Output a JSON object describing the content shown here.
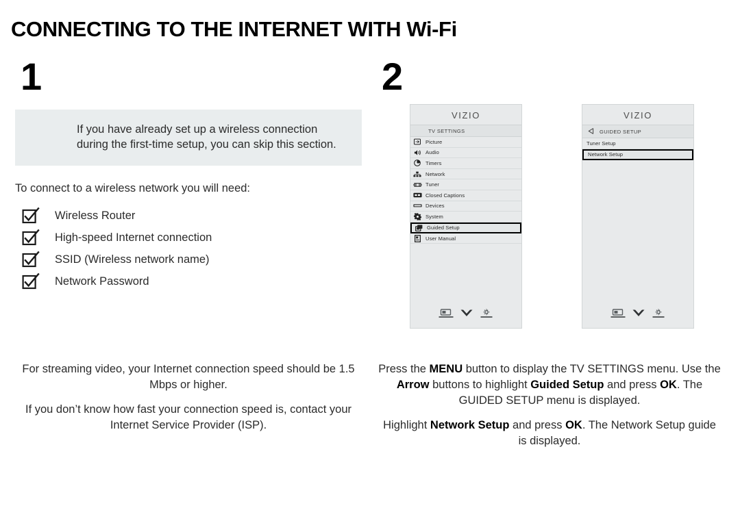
{
  "page": {
    "title": "CONNECTING TO THE INTERNET WITH Wi-Fi"
  },
  "steps": {
    "one": "1",
    "two": "2"
  },
  "left_column": {
    "callout_text": "If you have already set up a wireless connection during the first-time setup, you can skip this section.",
    "lead_line": "To connect to a wireless network you will need:",
    "checklist": [
      {
        "label": "Wireless Router",
        "icon": "checkbox-checked-icon"
      },
      {
        "label": "High-speed Internet connection",
        "icon": "checkbox-checked-icon"
      },
      {
        "label": "SSID (Wireless network name)",
        "icon": "checkbox-checked-icon"
      },
      {
        "label": "Network Password",
        "icon": "checkbox-checked-icon"
      }
    ],
    "note_p1": "For streaming video, your Internet connection speed should be 1.5 Mbps or higher.",
    "note_p2": "If you don’t know how fast your connection speed is, contact your Internet Service Provider (ISP)."
  },
  "right_column": {
    "note_1": {
      "t1": "Press the ",
      "b1": "MENU",
      "t2": " button to display the TV SETTINGS menu. Use the ",
      "b2": "Arrow",
      "t3": " buttons to highlight ",
      "b3": "Guided Setup",
      "t4": " and press ",
      "b4": "OK",
      "t5": ". The GUIDED SETUP menu is displayed."
    },
    "note_2": {
      "t1": "Highlight ",
      "b1": "Network Setup",
      "t2": " and press ",
      "b2": "OK",
      "t3": ". The Network Setup guide is displayed."
    }
  },
  "tv_panel_1": {
    "brand": "VIZIO",
    "subhead": "TV SETTINGS",
    "rows": [
      {
        "label": "Picture",
        "icon": "picture-icon"
      },
      {
        "label": "Audio",
        "icon": "speaker-icon"
      },
      {
        "label": "Timers",
        "icon": "clock-icon"
      },
      {
        "label": "Network",
        "icon": "network-icon"
      },
      {
        "label": "Tuner",
        "icon": "tuner-icon"
      },
      {
        "label": "Closed Captions",
        "icon": "closed-captions-icon"
      },
      {
        "label": "Devices",
        "icon": "devices-icon"
      },
      {
        "label": "System",
        "icon": "gear-icon"
      },
      {
        "label": "Guided Setup",
        "icon": "guided-setup-icon",
        "selected": true
      },
      {
        "label": "User Manual",
        "icon": "user-manual-icon"
      }
    ],
    "footer_icons": [
      "screen-icon",
      "chevron-down-icon",
      "brightness-icon"
    ]
  },
  "tv_panel_2": {
    "brand": "VIZIO",
    "subhead": "GUIDED SETUP",
    "back_icon": "back-arrow-icon",
    "rows": [
      {
        "label": "Tuner Setup"
      },
      {
        "label": "Network Setup",
        "selected": true
      }
    ],
    "footer_icons": [
      "screen-icon",
      "chevron-down-icon",
      "brightness-icon"
    ]
  },
  "colors": {
    "callout_bg": "#e9edee",
    "panel_bg": "#e8eaeb",
    "selection_border": "#000000",
    "text": "#2b2b2b"
  }
}
